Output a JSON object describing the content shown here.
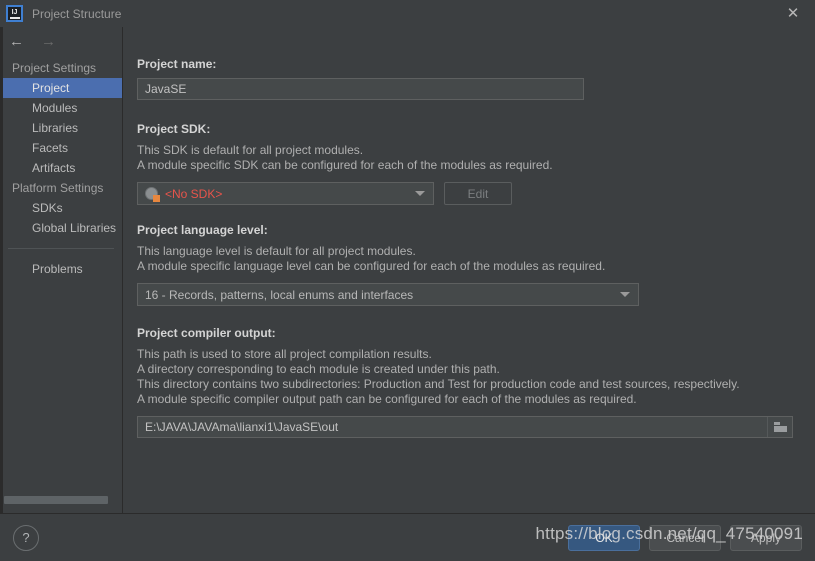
{
  "window": {
    "title": "Project Structure",
    "app_icon": "intellij-idea-icon",
    "close_icon": "✕"
  },
  "nav": {
    "back_icon": "←",
    "forward_icon": "→"
  },
  "sidebar": {
    "groups": [
      {
        "title": "Project Settings",
        "items": [
          {
            "label": "Project",
            "selected": true
          },
          {
            "label": "Modules",
            "selected": false
          },
          {
            "label": "Libraries",
            "selected": false
          },
          {
            "label": "Facets",
            "selected": false
          },
          {
            "label": "Artifacts",
            "selected": false
          }
        ]
      },
      {
        "title": "Platform Settings",
        "items": [
          {
            "label": "SDKs",
            "selected": false
          },
          {
            "label": "Global Libraries",
            "selected": false
          }
        ]
      }
    ],
    "problems_label": "Problems"
  },
  "main": {
    "project_name": {
      "label": "Project name:",
      "value": "JavaSE"
    },
    "project_sdk": {
      "label": "Project SDK:",
      "desc1": "This SDK is default for all project modules.",
      "desc2": "A module specific SDK can be configured for each of the modules as required.",
      "value": "<No SDK>",
      "value_color": "#e8544b",
      "icon": "sdk-globe-icon",
      "edit_button": "Edit"
    },
    "language_level": {
      "label": "Project language level:",
      "desc1": "This language level is default for all project modules.",
      "desc2": "A module specific language level can be configured for each of the modules as required.",
      "value": "16 - Records, patterns, local enums and interfaces"
    },
    "compiler_output": {
      "label": "Project compiler output:",
      "desc1": "This path is used to store all project compilation results.",
      "desc2": "A directory corresponding to each module is created under this path.",
      "desc3": "This directory contains two subdirectories: Production and Test for production code and test sources, respectively.",
      "desc4": "A module specific compiler output path can be configured for each of the modules as required.",
      "value": "E:\\JAVA\\JAVAma\\lianxi1\\JavaSE\\out",
      "browse_icon": "folder-icon"
    }
  },
  "footer": {
    "help_label": "?",
    "ok_label": "OK",
    "cancel_label": "Cancel",
    "apply_label": "Apply"
  },
  "watermark": {
    "text": "https://blog.csdn.net/qq_47540091"
  },
  "colors": {
    "accent_selection": "#4b6eaf",
    "primary_button": "#365880",
    "error_text": "#e8544b",
    "background": "#3c3f41",
    "field_background": "#45494a"
  }
}
